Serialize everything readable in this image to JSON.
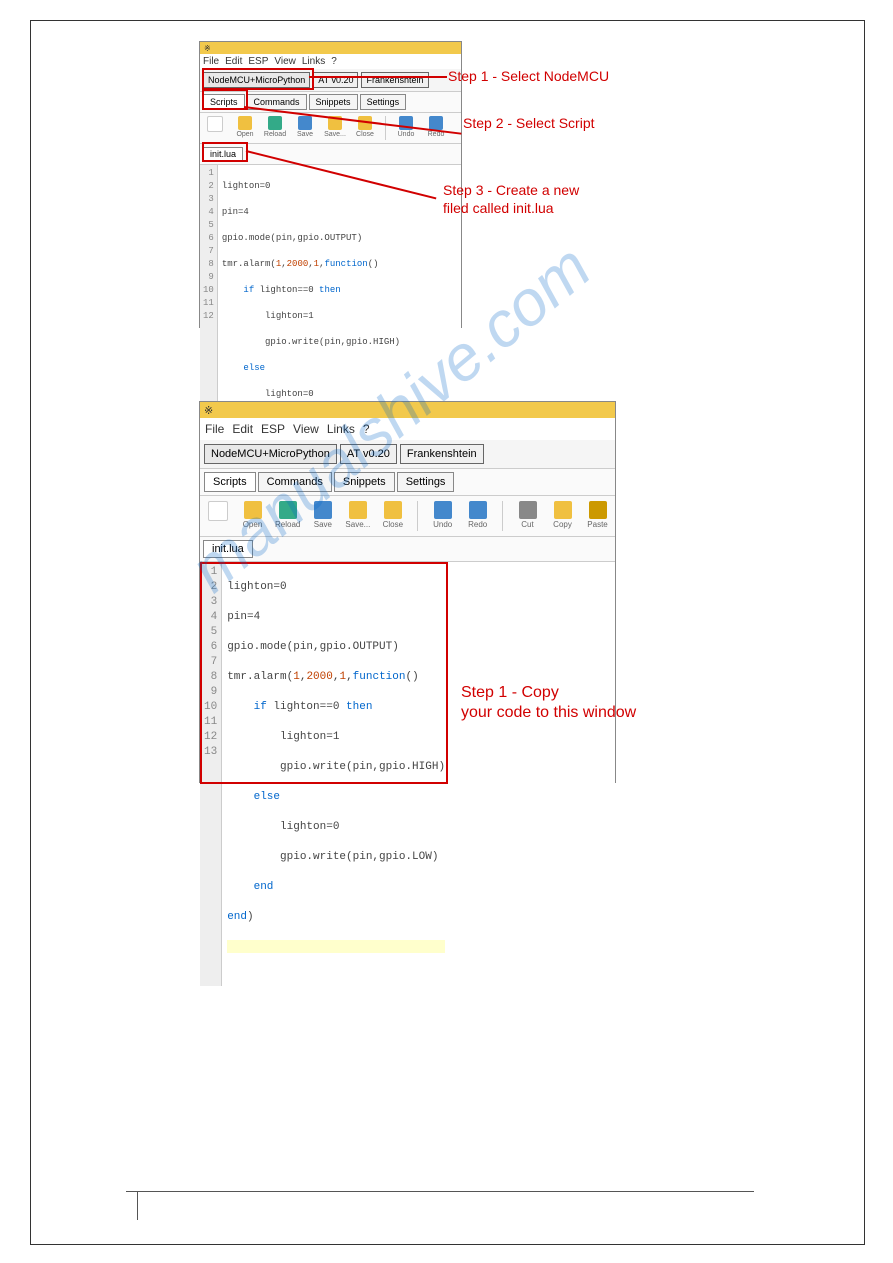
{
  "menus": {
    "file": "File",
    "edit": "Edit",
    "esp": "ESP",
    "view": "View",
    "links": "Links",
    "q": "?"
  },
  "firmware_tabs": {
    "nodemcu": "NodeMCU+MicroPython",
    "at": "AT v0.20",
    "frank": "Frankenshtein"
  },
  "sub_tabs": {
    "scripts": "Scripts",
    "commands": "Commands",
    "snippets": "Snippets",
    "settings": "Settings"
  },
  "tools": {
    "open": "Open",
    "reload": "Reload",
    "save": "Save",
    "saveas": "Save...",
    "close": "Close",
    "undo": "Undo",
    "redo": "Redo",
    "cut": "Cut",
    "copy": "Copy",
    "paste": "Paste"
  },
  "file_tab": "init.lua",
  "title_icon": "※",
  "code": {
    "l1": "lighton=0",
    "l2": "pin=4",
    "l3": "gpio.mode(pin,gpio.OUTPUT)",
    "l4_a": "tmr.alarm(",
    "l4_b": "1",
    "l4_c": ",",
    "l4_d": "2000",
    "l4_e": ",",
    "l4_f": "1",
    "l4_g": ",",
    "l4_h": "function",
    "l4_i": "()",
    "l5_a": "if",
    "l5_b": " lighton==0 ",
    "l5_c": "then",
    "l6": "lighton=1",
    "l7": "gpio.write(pin,gpio.HIGH)",
    "l8": "else",
    "l9": "lighton=0",
    "l10": "gpio.write(pin,gpio.LOW)",
    "l11": "end",
    "l12": "end",
    "l12b": ")"
  },
  "ln": [
    "1",
    "2",
    "3",
    "4",
    "5",
    "6",
    "7",
    "8",
    "9",
    "10",
    "11",
    "12",
    "13"
  ],
  "annotations": {
    "s1": "Step 1 - Select NodeMCU",
    "s2": "Step 2 - Select Script",
    "s3a": "Step 3 - Create a new",
    "s3b": "filed called init.lua",
    "s4a": "Step 1 - Copy",
    "s4b": "your code to this window"
  },
  "watermark": "manualshive.com"
}
